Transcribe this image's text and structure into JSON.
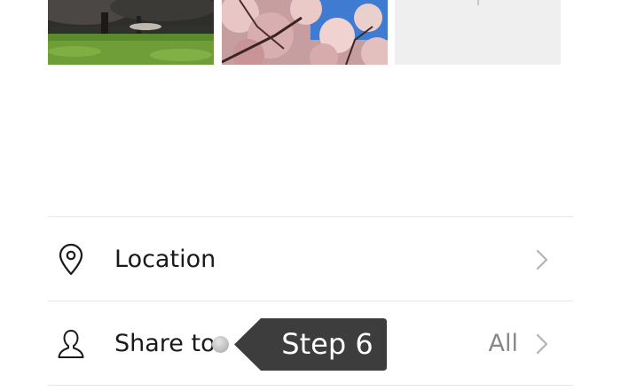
{
  "photos": [
    {
      "icon": "park-trees-photo"
    },
    {
      "icon": "cherry-blossom-photo"
    }
  ],
  "add_tile": {
    "icon": "plus-icon"
  },
  "rows": {
    "location": {
      "label": "Location",
      "icon": "location-pin-icon"
    },
    "share": {
      "label": "Share to",
      "value": "All",
      "icon": "person-icon"
    }
  },
  "tooltip": {
    "text": "Step 6"
  },
  "colors": {
    "tooltip_bg": "#3d3d3d",
    "divider": "#e6e6e6",
    "value_text": "#888888",
    "chevron": "#b3b3b3"
  }
}
